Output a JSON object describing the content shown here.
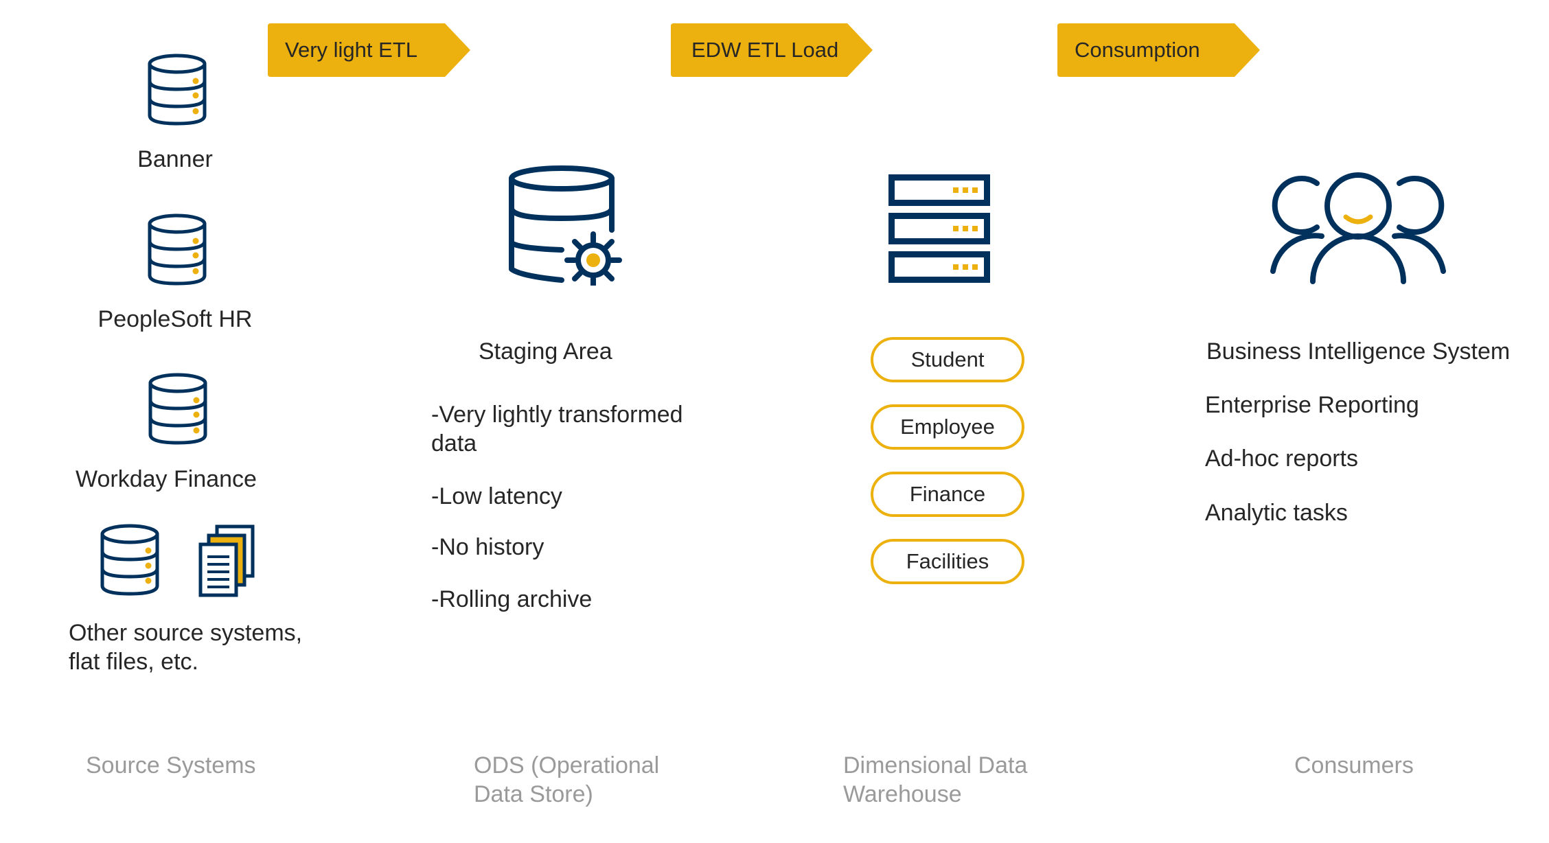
{
  "colors": {
    "accent_gold": "#EDB10F",
    "navy": "#00305C",
    "text": "#262626",
    "footer_text": "#9A9A9A"
  },
  "stages": [
    {
      "label": "Very light ETL"
    },
    {
      "label": "EDW ETL Load"
    },
    {
      "label": "Consumption"
    }
  ],
  "source_systems": {
    "items": [
      {
        "label": "Banner",
        "icon": "database-icon"
      },
      {
        "label": "PeopleSoft HR",
        "icon": "database-icon"
      },
      {
        "label": "Workday Finance",
        "icon": "database-icon"
      }
    ],
    "other": {
      "line1": "Other source systems,",
      "line2": "flat files, etc.",
      "icons": [
        "database-icon",
        "documents-icon"
      ]
    },
    "footer": "Source Systems"
  },
  "ods": {
    "icon": "database-gear-icon",
    "title": "Staging Area",
    "bullets": [
      {
        "line1": "-Very lightly transformed",
        "line2": "data"
      },
      {
        "line1": "-Low latency"
      },
      {
        "line1": "-No history"
      },
      {
        "line1": "-Rolling archive"
      }
    ],
    "footer_line1": "ODS (Operational",
    "footer_line2": "Data Store)"
  },
  "warehouse": {
    "icon": "server-stack-icon",
    "subjects": [
      "Student",
      "Employee",
      "Finance",
      "Facilities"
    ],
    "footer_line1": "Dimensional Data",
    "footer_line2": "Warehouse"
  },
  "consumers": {
    "icon": "users-group-icon",
    "items": [
      "Business Intelligence System",
      "Enterprise Reporting",
      "Ad-hoc reports",
      "Analytic tasks"
    ],
    "footer": "Consumers"
  }
}
